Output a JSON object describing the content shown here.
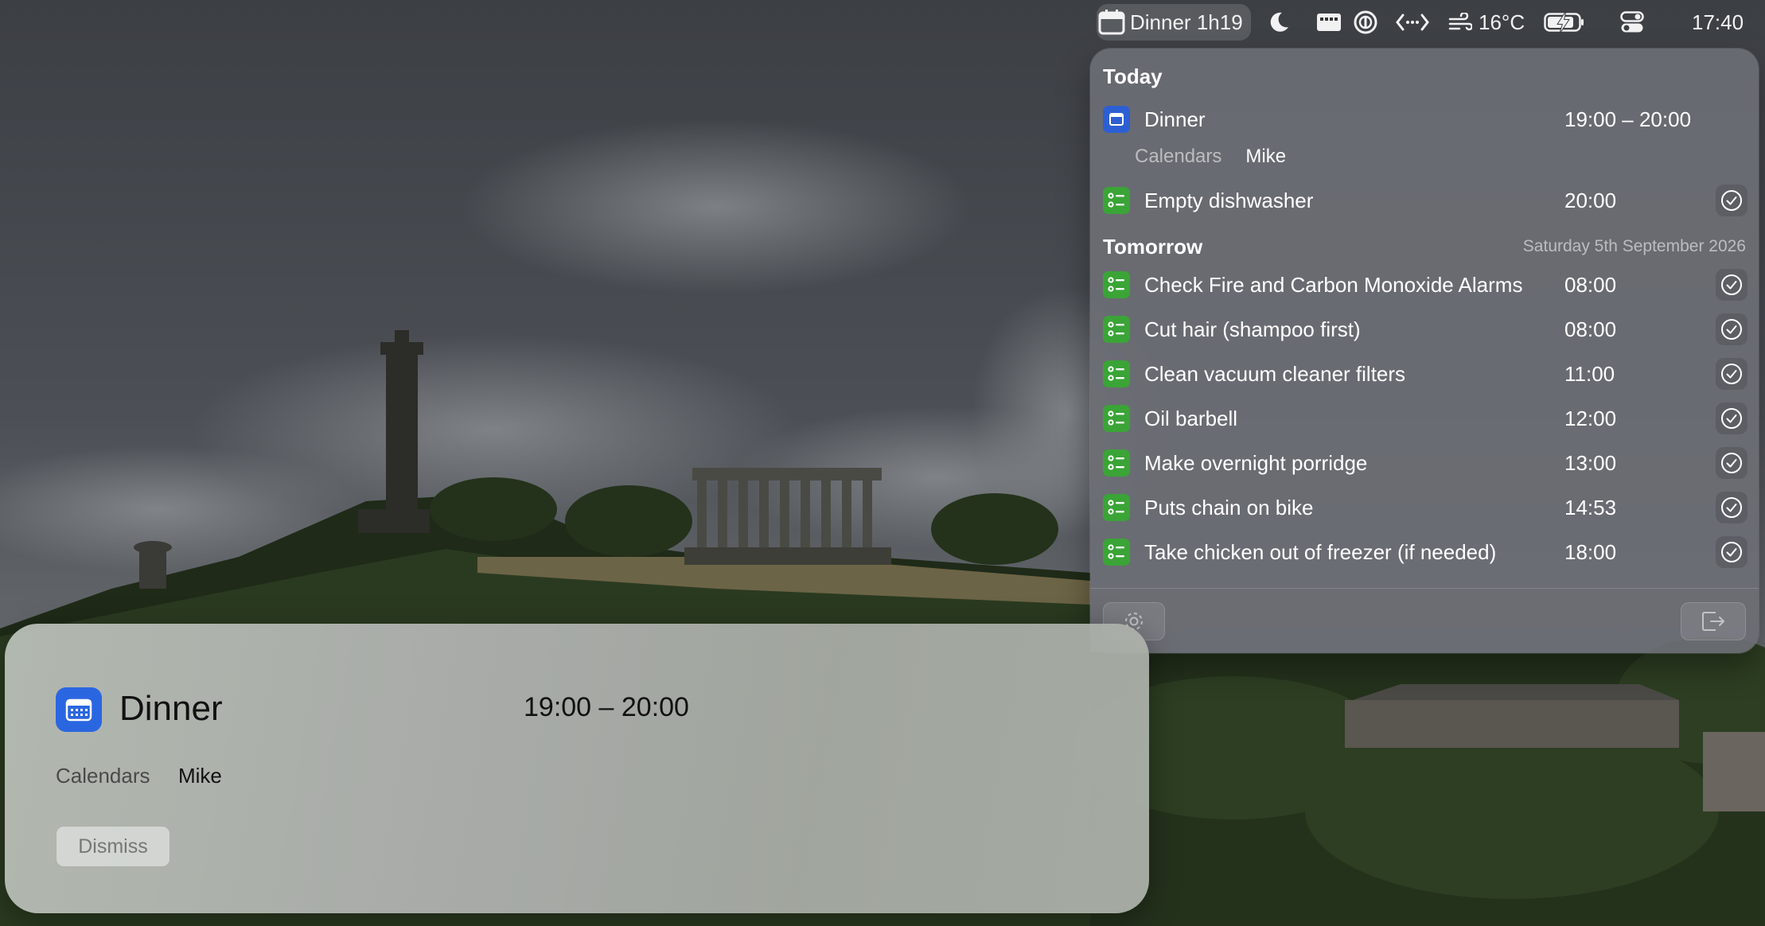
{
  "menubar": {
    "event_label": "Dinner 1h19",
    "weather": "16°C",
    "clock": "17:40",
    "icons": [
      "calendar-icon",
      "moon-icon",
      "display-icon",
      "password-icon",
      "code-icon",
      "wind-icon",
      "battery-charging-icon",
      "control-center-icon"
    ]
  },
  "panel": {
    "today_title": "Today",
    "today_event": {
      "title": "Dinner",
      "time": "19:00 – 20:00",
      "calendar_label": "Calendars",
      "calendar_value": "Mike"
    },
    "today_reminders": [
      {
        "title": "Empty dishwasher",
        "time": "20:00"
      }
    ],
    "tomorrow_title": "Tomorrow",
    "tomorrow_date": "Saturday 5th September 2026",
    "tomorrow_reminders": [
      {
        "title": "Check Fire and Carbon Monoxide Alarms",
        "time": "08:00"
      },
      {
        "title": "Cut hair (shampoo first)",
        "time": "08:00"
      },
      {
        "title": "Clean vacuum cleaner filters",
        "time": "11:00"
      },
      {
        "title": "Oil barbell",
        "time": "12:00"
      },
      {
        "title": "Make overnight porridge",
        "time": "13:00"
      },
      {
        "title": "Puts chain on bike",
        "time": "14:53"
      },
      {
        "title": "Take chicken out of freezer (if needed)",
        "time": "18:00"
      }
    ]
  },
  "notification": {
    "title": "Dinner",
    "time": "19:00 – 20:00",
    "calendar_label": "Calendars",
    "calendar_value": "Mike",
    "dismiss_label": "Dismiss"
  },
  "colors": {
    "calendar_accent": "#2a66e0",
    "reminder_accent": "#3aa436"
  }
}
